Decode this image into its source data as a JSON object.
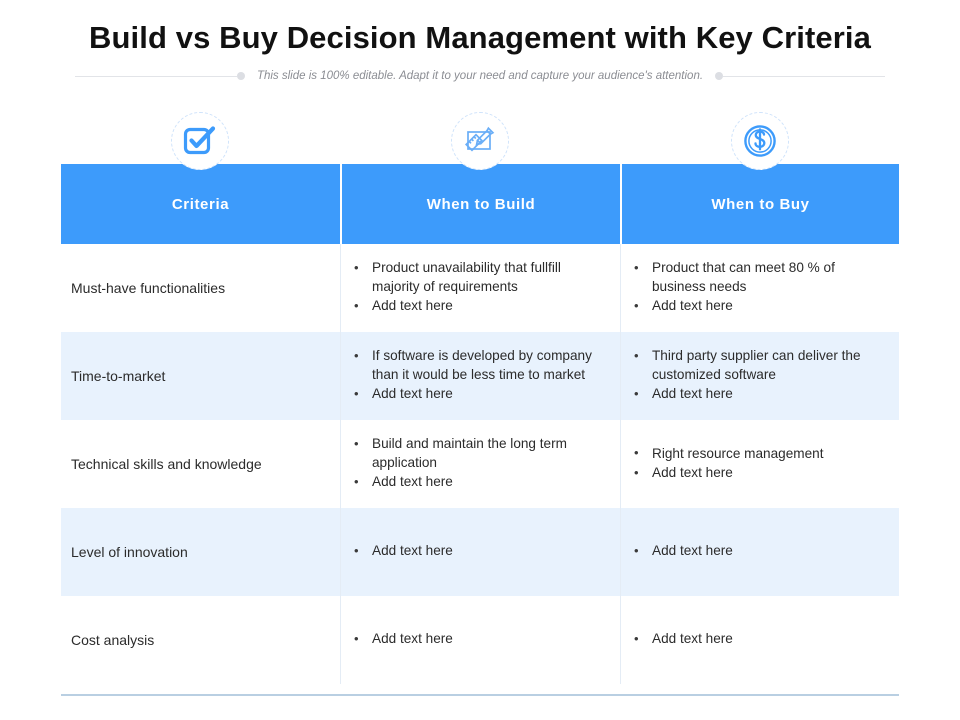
{
  "slide": {
    "title": "Build vs Buy Decision Management with Key Criteria",
    "subtitle": "This slide is 100% editable. Adapt it to your need and capture your audience's attention.",
    "accent_color": "#3d9bfb",
    "zebra_color": "#e8f2fd",
    "bottom_rule_color": "#b9cfe2"
  },
  "icons": [
    {
      "name": "checkbox-check-icon",
      "label": "Criteria"
    },
    {
      "name": "ruler-pencil-icon",
      "label": "When to Build"
    },
    {
      "name": "dollar-coin-icon",
      "label": "When to Buy"
    }
  ],
  "table": {
    "headers": [
      "Criteria",
      "When to Build",
      "When to Buy"
    ],
    "rows": [
      {
        "criteria": "Must-have functionalities",
        "build": [
          "Product unavailability that fullfill majority of requirements",
          "Add text here"
        ],
        "buy": [
          "Product that can meet  80 % of business needs",
          "Add text here"
        ],
        "zebra": false
      },
      {
        "criteria": "Time-to-market",
        "build": [
          "If software is developed by company than it would be less time to market",
          "Add text here"
        ],
        "buy": [
          "Third party supplier can deliver the customized software",
          "Add text here"
        ],
        "zebra": true
      },
      {
        "criteria": "Technical skills and knowledge",
        "build": [
          "Build and maintain the long term application",
          "Add text here"
        ],
        "buy": [
          "Right resource management",
          "Add text here"
        ],
        "zebra": false
      },
      {
        "criteria": "Level of innovation",
        "build": [
          "Add text here"
        ],
        "buy": [
          "Add text here"
        ],
        "zebra": true
      },
      {
        "criteria": "Cost analysis",
        "build": [
          "Add text here"
        ],
        "buy": [
          "Add text here"
        ],
        "zebra": false
      }
    ]
  }
}
